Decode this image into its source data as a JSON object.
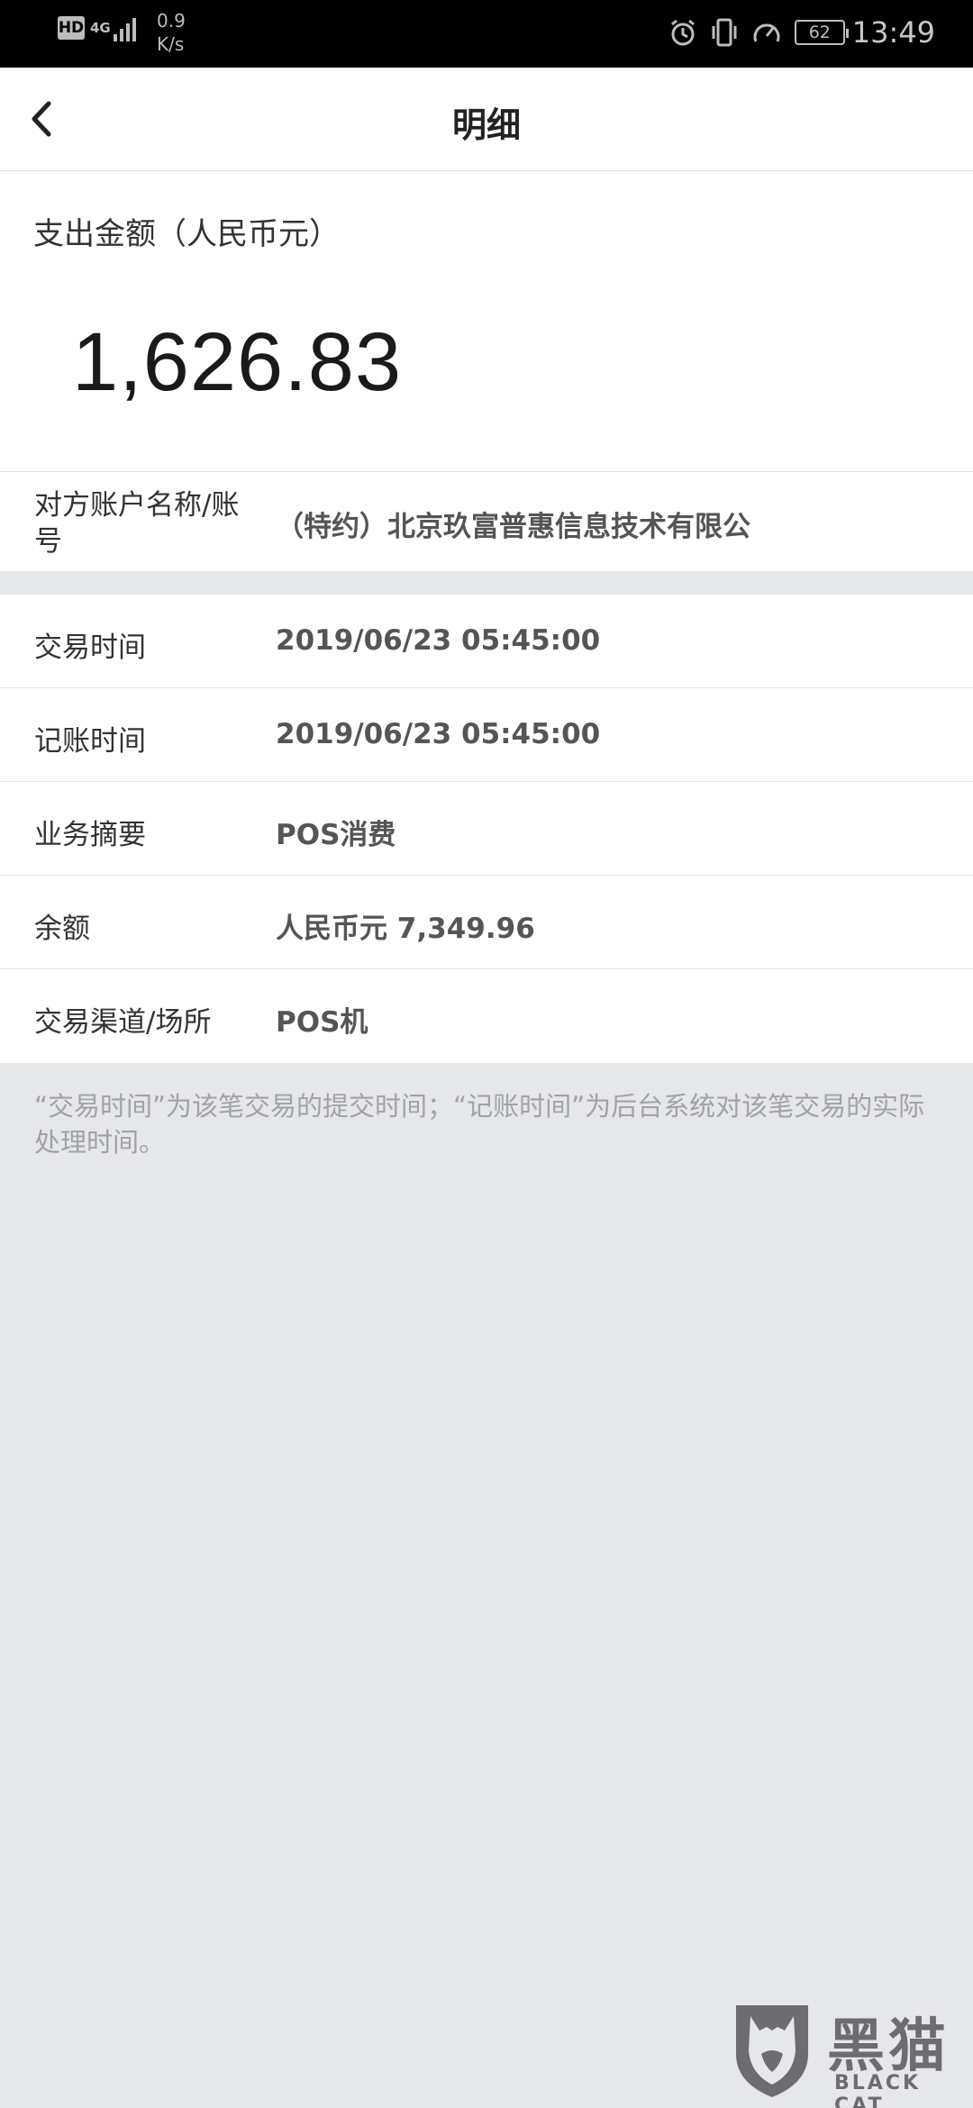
{
  "status_bar": {
    "hd": "HD",
    "network": "4G",
    "speed_value": "0.9",
    "speed_unit": "K/s",
    "battery": "62",
    "time": "13:49"
  },
  "nav": {
    "title": "明细"
  },
  "amount": {
    "label": "支出金额（人民币元）",
    "value": "1,626.83"
  },
  "counterparty": {
    "label": "对方账户名称/账号",
    "value": "（特约）北京玖富普惠信息技术有限公"
  },
  "details": [
    {
      "label": "交易时间",
      "value": "2019/06/23  05:45:00"
    },
    {
      "label": "记账时间",
      "value": "2019/06/23  05:45:00"
    },
    {
      "label": "业务摘要",
      "value": "POS消费"
    },
    {
      "label": "余额",
      "value": "人民币元 7,349.96"
    },
    {
      "label": "交易渠道/场所",
      "value": "POS机"
    }
  ],
  "footnote": "“交易时间”为该笔交易的提交时间；“记账时间”为后台系统对该笔交易的实际处理时间。",
  "watermark": {
    "cn": "黑猫",
    "en": "BLACK CAT"
  }
}
